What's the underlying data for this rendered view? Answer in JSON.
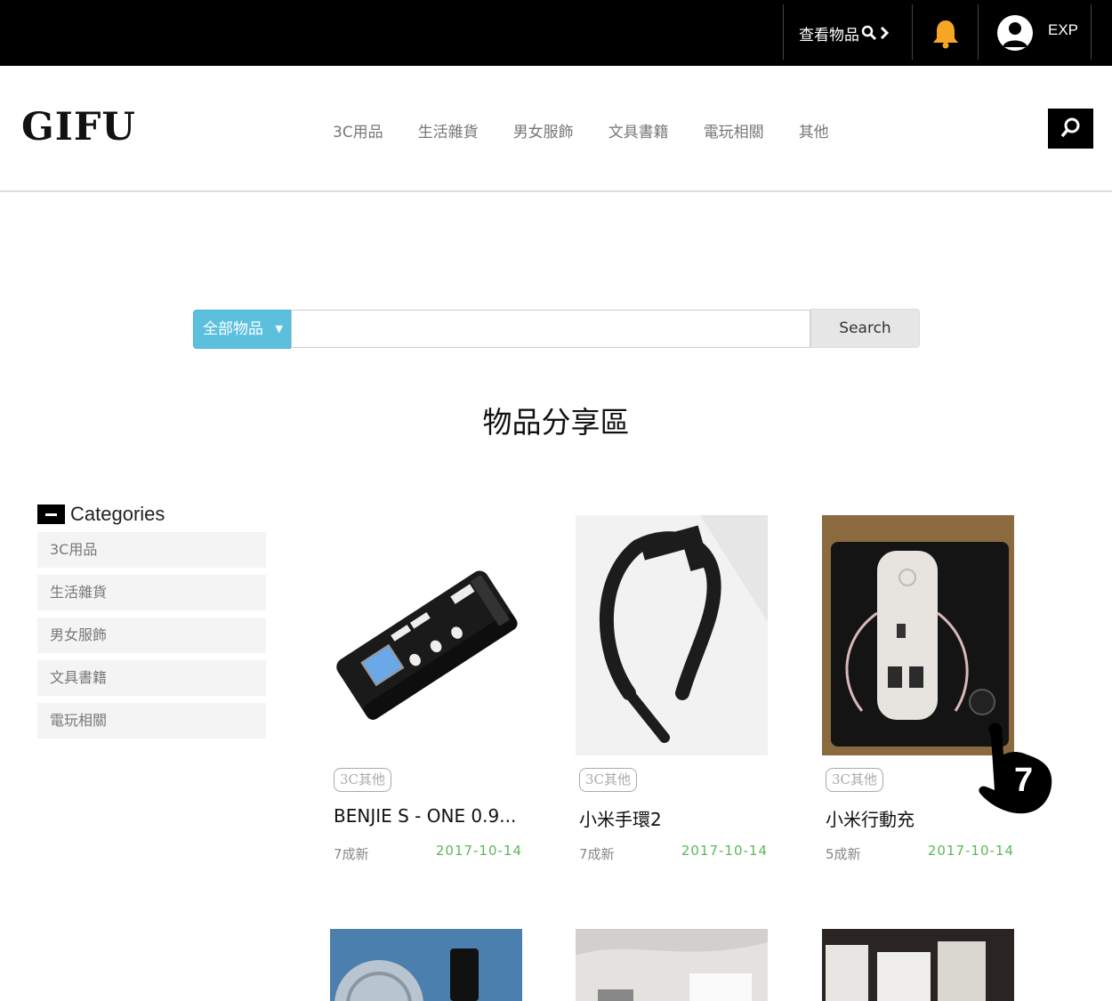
{
  "topbar": {
    "view_items_label": "查看物品",
    "user_label": "EXP",
    "icons": [
      "search-zoom-icon",
      "chevron-right-icon",
      "bell-icon",
      "user-avatar-icon"
    ],
    "bell_color": "#f5a623"
  },
  "header": {
    "logo": "GIFU",
    "nav": [
      "3C用品",
      "生活雜貨",
      "男女服飾",
      "文具書籍",
      "電玩相關",
      "其他"
    ]
  },
  "search": {
    "category_label": "全部物品",
    "input_value": "",
    "button_label": "Search",
    "accent": "#5bc0de"
  },
  "section_title": "物品分享區",
  "sidebar": {
    "title": "Categories",
    "items": [
      "3C用品",
      "生活雜貨",
      "男女服飾",
      "文具書籍",
      "電玩相關"
    ]
  },
  "products": [
    {
      "tag": "3C其他",
      "name": "BENJIE S - ONE 0.9...",
      "condition": "7成新",
      "date": "2017-10-14"
    },
    {
      "tag": "3C其他",
      "name": "小米手環2",
      "condition": "7成新",
      "date": "2017-10-14"
    },
    {
      "tag": "3C其他",
      "name": "小米行動充",
      "condition": "5成新",
      "date": "2017-10-14"
    }
  ],
  "annotation": {
    "step_number": "7"
  }
}
